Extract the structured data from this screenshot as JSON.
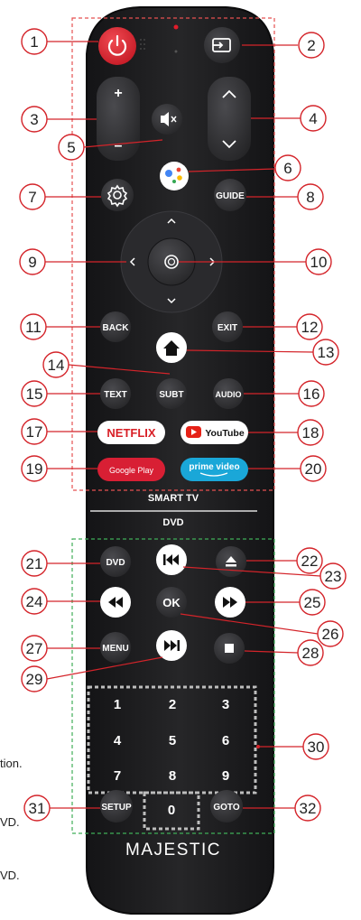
{
  "callouts": [
    "1",
    "2",
    "3",
    "4",
    "5",
    "6",
    "7",
    "8",
    "9",
    "10",
    "11",
    "12",
    "13",
    "14",
    "15",
    "16",
    "17",
    "18",
    "19",
    "20",
    "21",
    "22",
    "23",
    "24",
    "25",
    "26",
    "27",
    "28",
    "29",
    "30",
    "31",
    "32"
  ],
  "buttons": {
    "plus": "+",
    "minus": "–",
    "guide": "GUIDE",
    "back": "BACK",
    "exit": "EXIT",
    "text": "TEXT",
    "subt": "SUBT",
    "audio": "AUDIO",
    "netflix": "NETFLIX",
    "youtube": "YouTube",
    "google_play": "Google Play",
    "prime_video_1": "prime video",
    "dvd": "DVD",
    "ok": "OK",
    "menu": "MENU",
    "setup": "SETUP",
    "goto": "GOTO",
    "digits": [
      "1",
      "2",
      "3",
      "4",
      "5",
      "6",
      "7",
      "8",
      "9",
      "0"
    ]
  },
  "section_labels": {
    "smart_tv": "SMART TV",
    "dvd": "DVD"
  },
  "brand": "MAJESTIC",
  "background_text": [
    "tion.",
    "VD.",
    "VD."
  ],
  "colors": {
    "body": "#1d1d1f",
    "power_red": "#e11c2a",
    "netflix_red": "#d81f26",
    "prime_blue": "#1aa7d8",
    "callout_red": "#d4242a",
    "smart_dash": "#e55050",
    "dvd_dash": "#3fae58"
  }
}
